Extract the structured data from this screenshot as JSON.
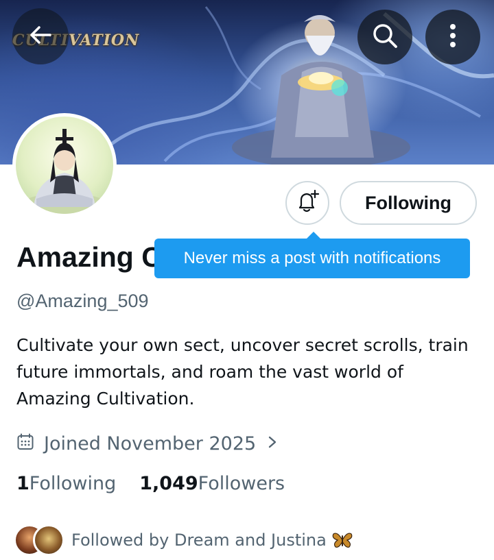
{
  "banner": {
    "logo_text": "CULTIVATION"
  },
  "profile": {
    "name": "Amazing Cultivation",
    "handle": "@Amazing_509",
    "bio": "Cultivate your own sect, uncover secret scrolls, train future immortals, and roam the vast world of Amazing Cultivation.",
    "joined": "Joined November 2025"
  },
  "actions": {
    "following_label": "Following",
    "tooltip": "Never miss a post with notifications"
  },
  "stats": {
    "following_count": "1",
    "following_label": "Following",
    "followers_count": "1,049",
    "followers_label": "Followers"
  },
  "followed_by": "Followed by Dream and Justina",
  "icons": [
    "back-arrow-icon",
    "search-icon",
    "more-vertical-icon",
    "bell-plus-icon",
    "calendar-icon",
    "chevron-right-icon",
    "butterfly-emoji-icon"
  ],
  "colors": {
    "accent": "#1d9bf0",
    "text_primary": "#0f1419",
    "text_secondary": "#536471",
    "border": "#cfd9de"
  }
}
